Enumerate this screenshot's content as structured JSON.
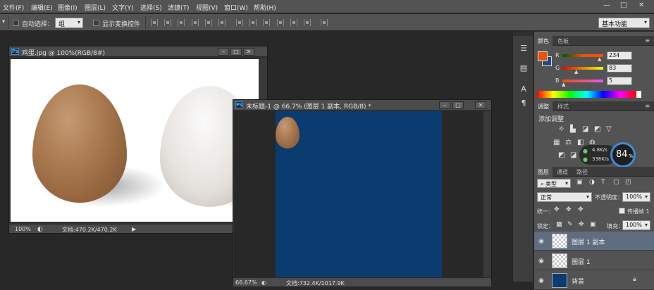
{
  "menubar": {
    "items": [
      "文件(F)",
      "编辑(E)",
      "图像(I)",
      "图层(L)",
      "文字(Y)",
      "选择(S)",
      "滤镜(T)",
      "视图(V)",
      "窗口(W)",
      "帮助(H)"
    ],
    "window_controls": {
      "minimize": "—",
      "restore": "□",
      "close": "✕"
    }
  },
  "options": {
    "auto_select_label": "自动选择：",
    "auto_select_value": "组",
    "show_transform_label": "显示变换控件",
    "workspace": "基本功能"
  },
  "doc1": {
    "title": "鸡蛋.jpg @ 100%(RGB/8#)",
    "zoom": "100%",
    "docinfo": "文档:470.2K/470.2K"
  },
  "doc2": {
    "title": "未标题-1 @ 66.7% (图层 1 副本, RGB/8) *",
    "zoom": "66.67%",
    "docinfo": "文档:732.4K/1017.9K",
    "canvas_color": "#0b3c70"
  },
  "color_panel": {
    "tabs": [
      "颜色",
      "色板"
    ],
    "r_label": "R",
    "g_label": "G",
    "b_label": "B",
    "r": "234",
    "g": "83",
    "b": "5",
    "foreground": "#ea5305",
    "background": "#1f4a8a"
  },
  "adjust_panel": {
    "tabs": [
      "调整",
      "样式"
    ],
    "title": "添加调整",
    "net_up": "4.8K/s",
    "net_down": "336K/s",
    "cpu_percent": "84",
    "cpu_unit": "%"
  },
  "layers_panel": {
    "tabs": [
      "图层",
      "通道",
      "路径"
    ],
    "filter_kind": "类型",
    "blend_mode": "正常",
    "opacity_label": "不透明度：",
    "opacity": "100%",
    "unify_label": "统一：",
    "propagate_label": "传播帧 1",
    "lock_label": "锁定：",
    "fill_label": "填充：",
    "fill": "100%",
    "layers": [
      {
        "name": "图层 1 副本",
        "selected": true
      },
      {
        "name": "图层 1",
        "selected": false
      },
      {
        "name": "背景",
        "selected": false
      }
    ]
  }
}
